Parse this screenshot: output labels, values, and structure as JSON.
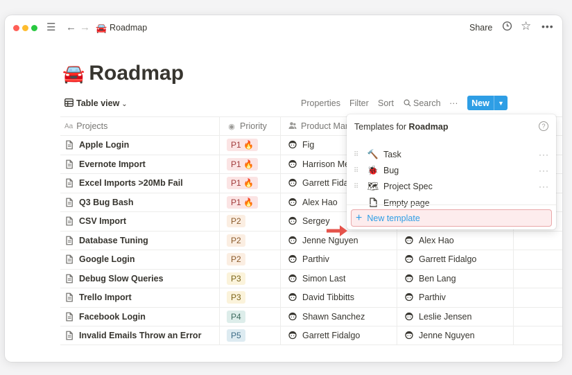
{
  "titlebar": {
    "page_emoji": "🚘",
    "breadcrumb": "Roadmap",
    "share_label": "Share"
  },
  "page": {
    "emoji": "🚘",
    "title": "Roadmap"
  },
  "toolbar": {
    "view_label": "Table view",
    "properties": "Properties",
    "filter": "Filter",
    "sort": "Sort",
    "search": "Search",
    "more": "···",
    "new_label": "New"
  },
  "table": {
    "headers": {
      "projects_icon": "Aa",
      "projects": "Projects",
      "priority": "Priority",
      "product_manager": "Product Man"
    },
    "rows": [
      {
        "project": "Apple Login",
        "priority": "P1 🔥",
        "pm": "Fig",
        "eng": ""
      },
      {
        "project": "Evernote Import",
        "priority": "P1 🔥",
        "pm": "Harrison Me",
        "eng": ""
      },
      {
        "project": "Excel Imports >20Mb Fail",
        "priority": "P1 🔥",
        "pm": "Garrett Fida",
        "eng": ""
      },
      {
        "project": "Q3 Bug Bash",
        "priority": "P1 🔥",
        "pm": "Alex Hao",
        "eng": ""
      },
      {
        "project": "CSV Import",
        "priority": "P2",
        "pm": "Sergey",
        "eng": ""
      },
      {
        "project": "Database Tuning",
        "priority": "P2",
        "pm": "Jenne Nguyen",
        "eng": "Alex Hao"
      },
      {
        "project": "Google Login",
        "priority": "P2",
        "pm": "Parthiv",
        "eng": "Garrett Fidalgo"
      },
      {
        "project": "Debug Slow Queries",
        "priority": "P3",
        "pm": "Simon Last",
        "eng": "Ben Lang"
      },
      {
        "project": "Trello Import",
        "priority": "P3",
        "pm": "David Tibbitts",
        "eng": "Parthiv"
      },
      {
        "project": "Facebook Login",
        "priority": "P4",
        "pm": "Shawn Sanchez",
        "eng": "Leslie Jensen"
      },
      {
        "project": "Invalid Emails Throw an Error",
        "priority": "P5",
        "pm": "Garrett Fidalgo",
        "eng": "Jenne Nguyen"
      }
    ]
  },
  "templates_popup": {
    "title_prefix": "Templates for",
    "title_db": "Roadmap",
    "items": [
      {
        "icon": "hammer-icon",
        "emoji": "🔨",
        "label": "Task"
      },
      {
        "icon": "bug-icon",
        "emoji": "🐞",
        "label": "Bug"
      },
      {
        "icon": "map-icon",
        "emoji": "🗺",
        "label": "Project Spec"
      },
      {
        "icon": "empty-page-icon",
        "emoji": "",
        "label": "Empty page"
      }
    ],
    "new_template": "New template"
  },
  "colors": {
    "accent": "#2e9ee5",
    "p1": "#fbe4e4",
    "p2": "#fbeee2",
    "p3": "#fbf3db",
    "p4": "#ddedea",
    "p5": "#ddebf1",
    "highlight_border": "#e9a7a9",
    "arrow": "#e5534b"
  }
}
